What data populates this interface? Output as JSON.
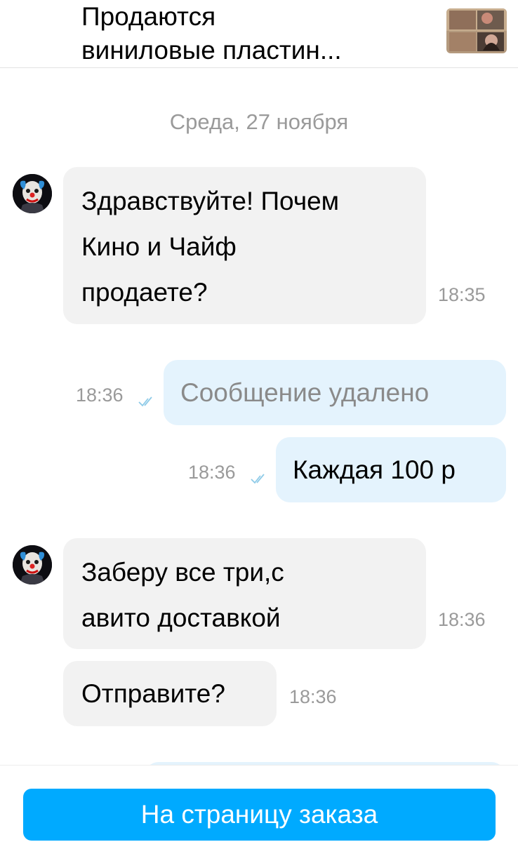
{
  "header": {
    "title_line1": "Продаются",
    "title_line2": "виниловые пластин...",
    "thumbnail_icon": "vinyl-listing-photo"
  },
  "date_separator": "Среда, 27 ноября",
  "messages": [
    {
      "direction": "in",
      "lines": [
        "Здравствуйте! Почем",
        "Кино и Чайф",
        "продаете?"
      ],
      "time": "18:35"
    },
    {
      "direction": "out",
      "text": "Сообщение удалено",
      "deleted": true,
      "time": "18:36",
      "status_icon": "double-check-icon"
    },
    {
      "direction": "out",
      "text": "Каждая 100 р",
      "deleted": false,
      "time": "18:36",
      "status_icon": "double-check-icon"
    },
    {
      "direction": "in",
      "lines": [
        "Заберу все три,с",
        "авито доставкой"
      ],
      "time": "18:36"
    },
    {
      "direction": "in",
      "lines": [
        "Отправите?"
      ],
      "time": "18:36"
    }
  ],
  "footer": {
    "order_button_label": "На страницу заказа"
  },
  "colors": {
    "accent": "#00aaff",
    "incoming_bubble": "#f2f2f2",
    "outgoing_bubble": "#e4f3fd",
    "muted_text": "#9a9a9a"
  }
}
